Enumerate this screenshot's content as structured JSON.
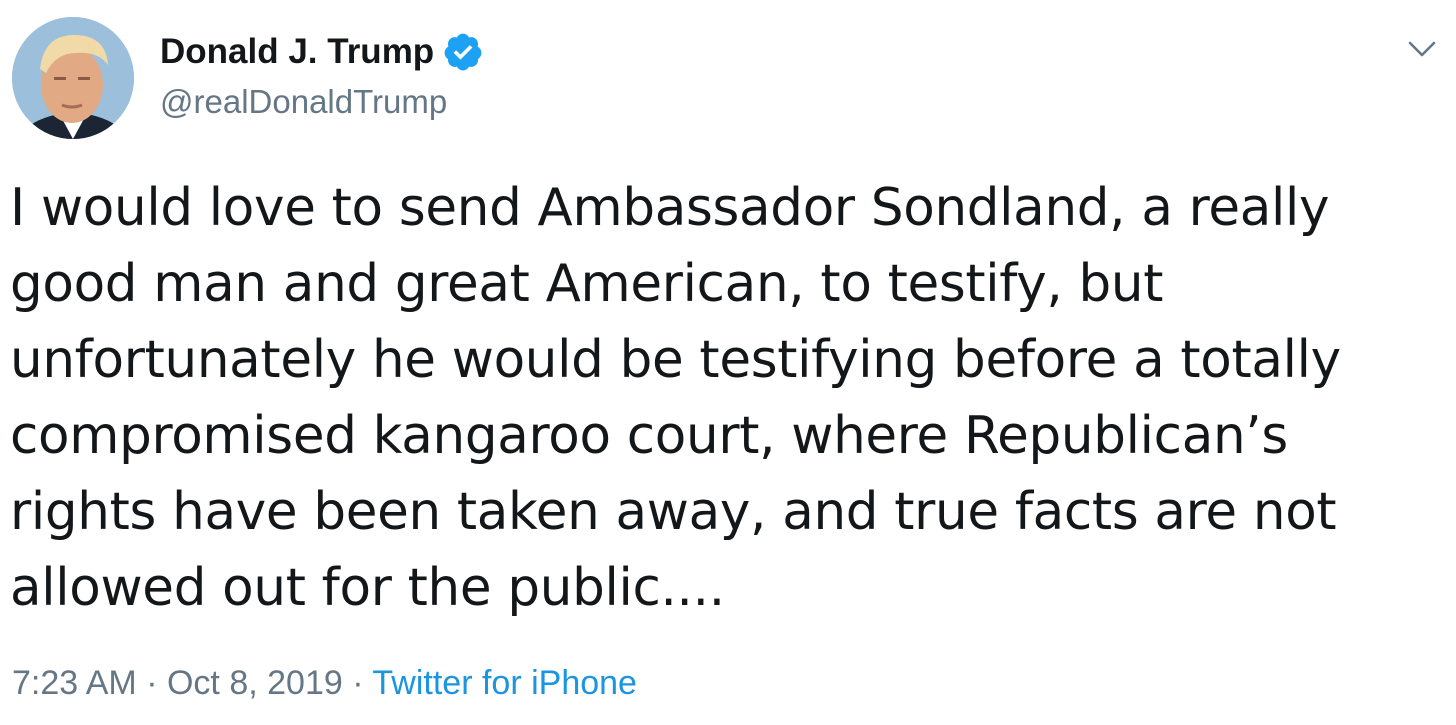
{
  "tweet": {
    "author": {
      "display_name": "Donald J. Trump",
      "handle": "@realDonaldTrump",
      "verified": true,
      "avatar_icon": "profile-photo"
    },
    "text": "I would love to send Ambassador Sondland, a really\ngood man and great American, to testify, but\nunfortunately he would be testifying before a totally\ncompromised kangaroo court, where Republican’s\nrights have been taken away, and true facts are not\nallowed out for the public....",
    "time": "7:23 AM",
    "separator": "·",
    "date": "Oct 8, 2019",
    "source": "Twitter for iPhone"
  },
  "menu": {
    "icon": "chevron-down-icon"
  },
  "colors": {
    "text": "#14171a",
    "secondary": "#657786",
    "link": "#1b95e0",
    "verified_badge": "#1da1f2"
  }
}
